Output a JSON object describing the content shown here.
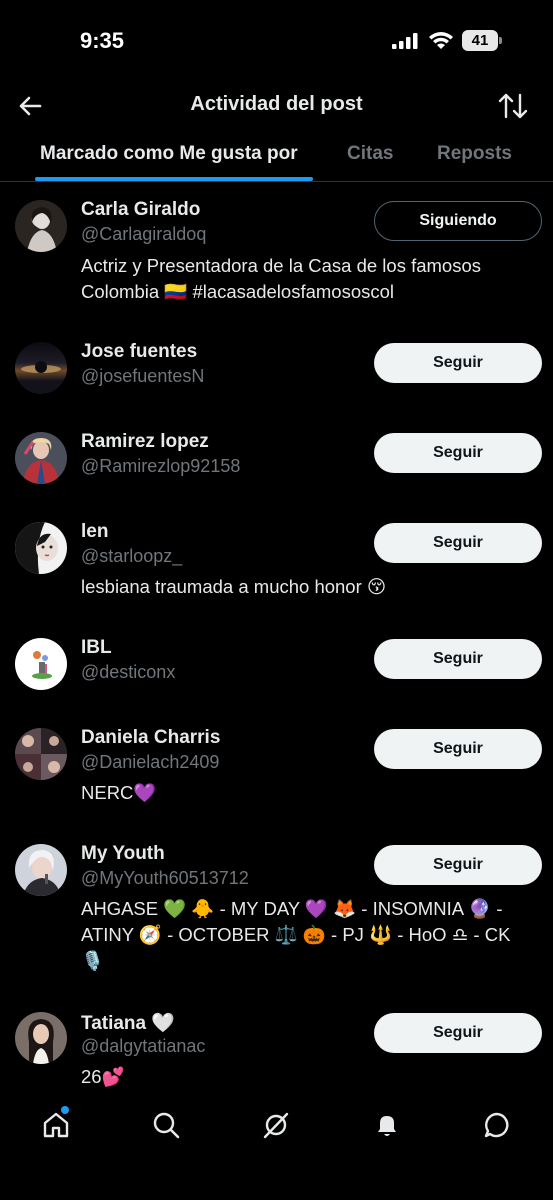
{
  "status_bar": {
    "time": "9:35",
    "battery": "41"
  },
  "header": {
    "title": "Actividad del post",
    "back_icon": "arrow-left-icon",
    "sort_icon": "sort-arrows-icon"
  },
  "tabs": [
    {
      "label": "Marcado como Me gusta por",
      "active": true
    },
    {
      "label": "Citas",
      "active": false
    },
    {
      "label": "Reposts",
      "active": false
    }
  ],
  "users": [
    {
      "name": "Carla Giraldo",
      "handle": "@Carlagiraldoq",
      "button": "Siguiendo",
      "bio_lines": [
        "Actriz y Presentadora de la Casa de los famosos",
        "Colombia 🇨🇴 #lacasadelosfamososcol"
      ]
    },
    {
      "name": "Jose fuentes",
      "handle": "@josefuentesN",
      "button": "Seguir",
      "bio_lines": []
    },
    {
      "name": "Ramirez lopez",
      "handle": "@Ramirezlop92158",
      "button": "Seguir",
      "bio_lines": []
    },
    {
      "name": "len",
      "handle": "@starloopz_",
      "button": "Seguir",
      "bio_lines": [
        "lesbiana traumada a mucho honor 😚"
      ]
    },
    {
      "name": "IBL",
      "handle": "@desticonx",
      "button": "Seguir",
      "bio_lines": []
    },
    {
      "name": "Daniela Charris",
      "handle": "@Danielach2409",
      "button": "Seguir",
      "bio_lines": [
        "NERC💜"
      ]
    },
    {
      "name": "My Youth",
      "handle": "@MyYouth60513712",
      "button": "Seguir",
      "bio_lines": [
        "AHGASE 💚 🐥 - MY DAY 💜 🦊 - INSOMNIA 🔮 -",
        "ATINY 🧭 - OCTOBER ⚖️ 🎃 - PJ 🔱 - HoO ♎ - CK",
        "🎙️"
      ]
    },
    {
      "name": "Tatiana 🤍",
      "handle": "@dalgytatianac",
      "button": "Seguir",
      "bio_lines": [
        "26💕"
      ]
    }
  ],
  "bottom_nav": [
    {
      "icon": "home-icon",
      "has_notification_dot": true
    },
    {
      "icon": "search-icon"
    },
    {
      "icon": "grok-icon"
    },
    {
      "icon": "bell-icon"
    },
    {
      "icon": "messages-icon"
    }
  ]
}
